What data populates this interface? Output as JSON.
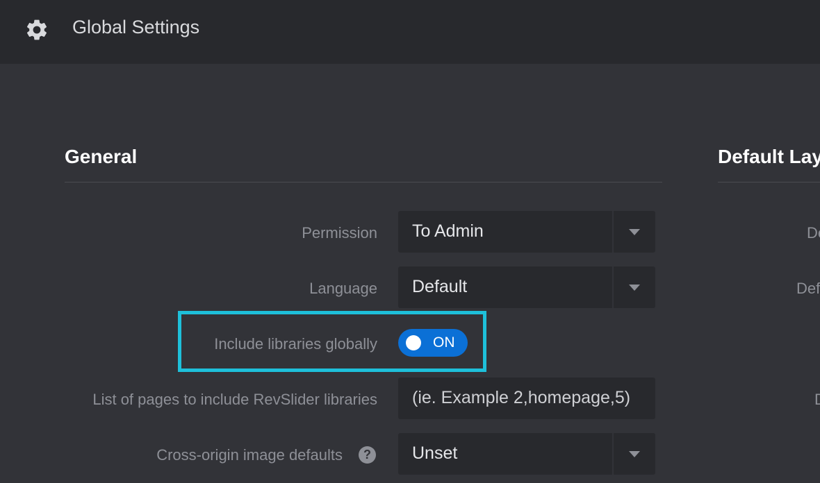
{
  "header": {
    "icon": "gear-icon",
    "title": "Global Settings"
  },
  "general": {
    "title": "General",
    "permission": {
      "label": "Permission",
      "value": "To Admin"
    },
    "language": {
      "label": "Language",
      "value": "Default"
    },
    "include_libraries": {
      "label": "Include libraries globally",
      "state": "ON"
    },
    "pages_list": {
      "label": "List of pages to include RevSlider libraries",
      "placeholder": "(ie. Example 2,homepage,5)"
    },
    "cross_origin": {
      "label": "Cross-origin image defaults",
      "help": "?",
      "value": "Unset"
    }
  },
  "default_layout": {
    "title": "Default Lay",
    "row1_label": "De",
    "row2_label": "Def",
    "row3_label": "D"
  },
  "colors": {
    "background": "#323338",
    "topbar": "#28292d",
    "toggle_on": "#0b70d6",
    "highlight": "#1ec0da"
  }
}
